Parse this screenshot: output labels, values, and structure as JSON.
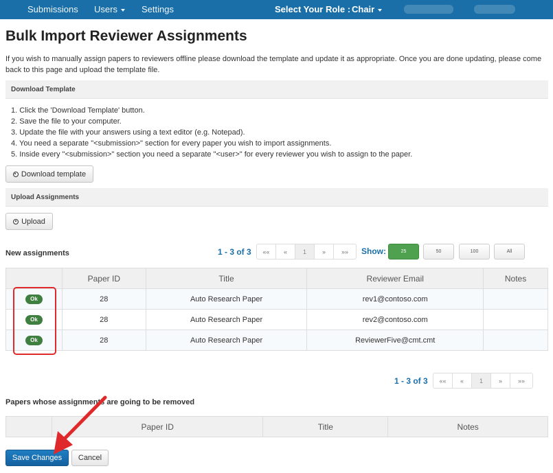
{
  "nav": {
    "items": [
      {
        "label": "Submissions",
        "has_caret": false
      },
      {
        "label": "Users",
        "has_caret": true
      },
      {
        "label": "Settings",
        "has_caret": false
      }
    ],
    "role_label": "Select Your Role :",
    "role_value": "Chair",
    "bar_color": "#1a6fa8"
  },
  "page": {
    "title": "Bulk Import Reviewer Assignments",
    "intro": "If you wish to manually assign papers to reviewers offline please download the template and update it as appropriate. Once you are done updating, please come back to this page and upload the template file."
  },
  "download_section": {
    "header": "Download Template",
    "steps": [
      "1. Click the 'Download Template' button.",
      "2. Save the file to your computer.",
      "3. Update the file with your answers using a text editor (e.g. Notepad).",
      "4. You need a separate \"<submission>\" section for every paper you wish to import assignments.",
      "5. Inside every \"<submission>\" section you need a separate \"<user>\" for every reviewer you wish to assign to the paper."
    ],
    "button_label": "Download template"
  },
  "upload_section": {
    "header": "Upload Assignments",
    "button_label": "Upload"
  },
  "new_assignments": {
    "label": "New assignments",
    "page_info": "1 - 3 of 3",
    "pager": [
      "««",
      "«",
      "1",
      "»",
      "»»"
    ],
    "show_label": "Show:",
    "page_sizes": [
      "25",
      "50",
      "100",
      "All"
    ],
    "active_page_size": "25",
    "columns": [
      "",
      "Paper ID",
      "Title",
      "Reviewer Email",
      "Notes"
    ],
    "rows": [
      {
        "status": "Ok",
        "paper_id": "28",
        "title": "Auto Research Paper",
        "email": "rev1@contoso.com",
        "notes": ""
      },
      {
        "status": "Ok",
        "paper_id": "28",
        "title": "Auto Research Paper",
        "email": "rev2@contoso.com",
        "notes": ""
      },
      {
        "status": "Ok",
        "paper_id": "28",
        "title": "Auto Research Paper",
        "email": "ReviewerFive@cmt.cmt",
        "notes": ""
      }
    ],
    "bottom_page_info": "1 - 3 of 3",
    "bottom_pager": [
      "««",
      "«",
      "1",
      "»",
      "»»"
    ]
  },
  "removed_assignments": {
    "label": "Papers whose assignments are going to be removed",
    "columns": [
      "",
      "Paper ID",
      "Title",
      "Notes"
    ]
  },
  "actions": {
    "save_label": "Save Changes",
    "cancel_label": "Cancel"
  },
  "colors": {
    "accent": "#1a6fa8",
    "ok_badge": "#3f7f3f",
    "active_size": "#4fa04f",
    "highlight": "#e0292a"
  }
}
